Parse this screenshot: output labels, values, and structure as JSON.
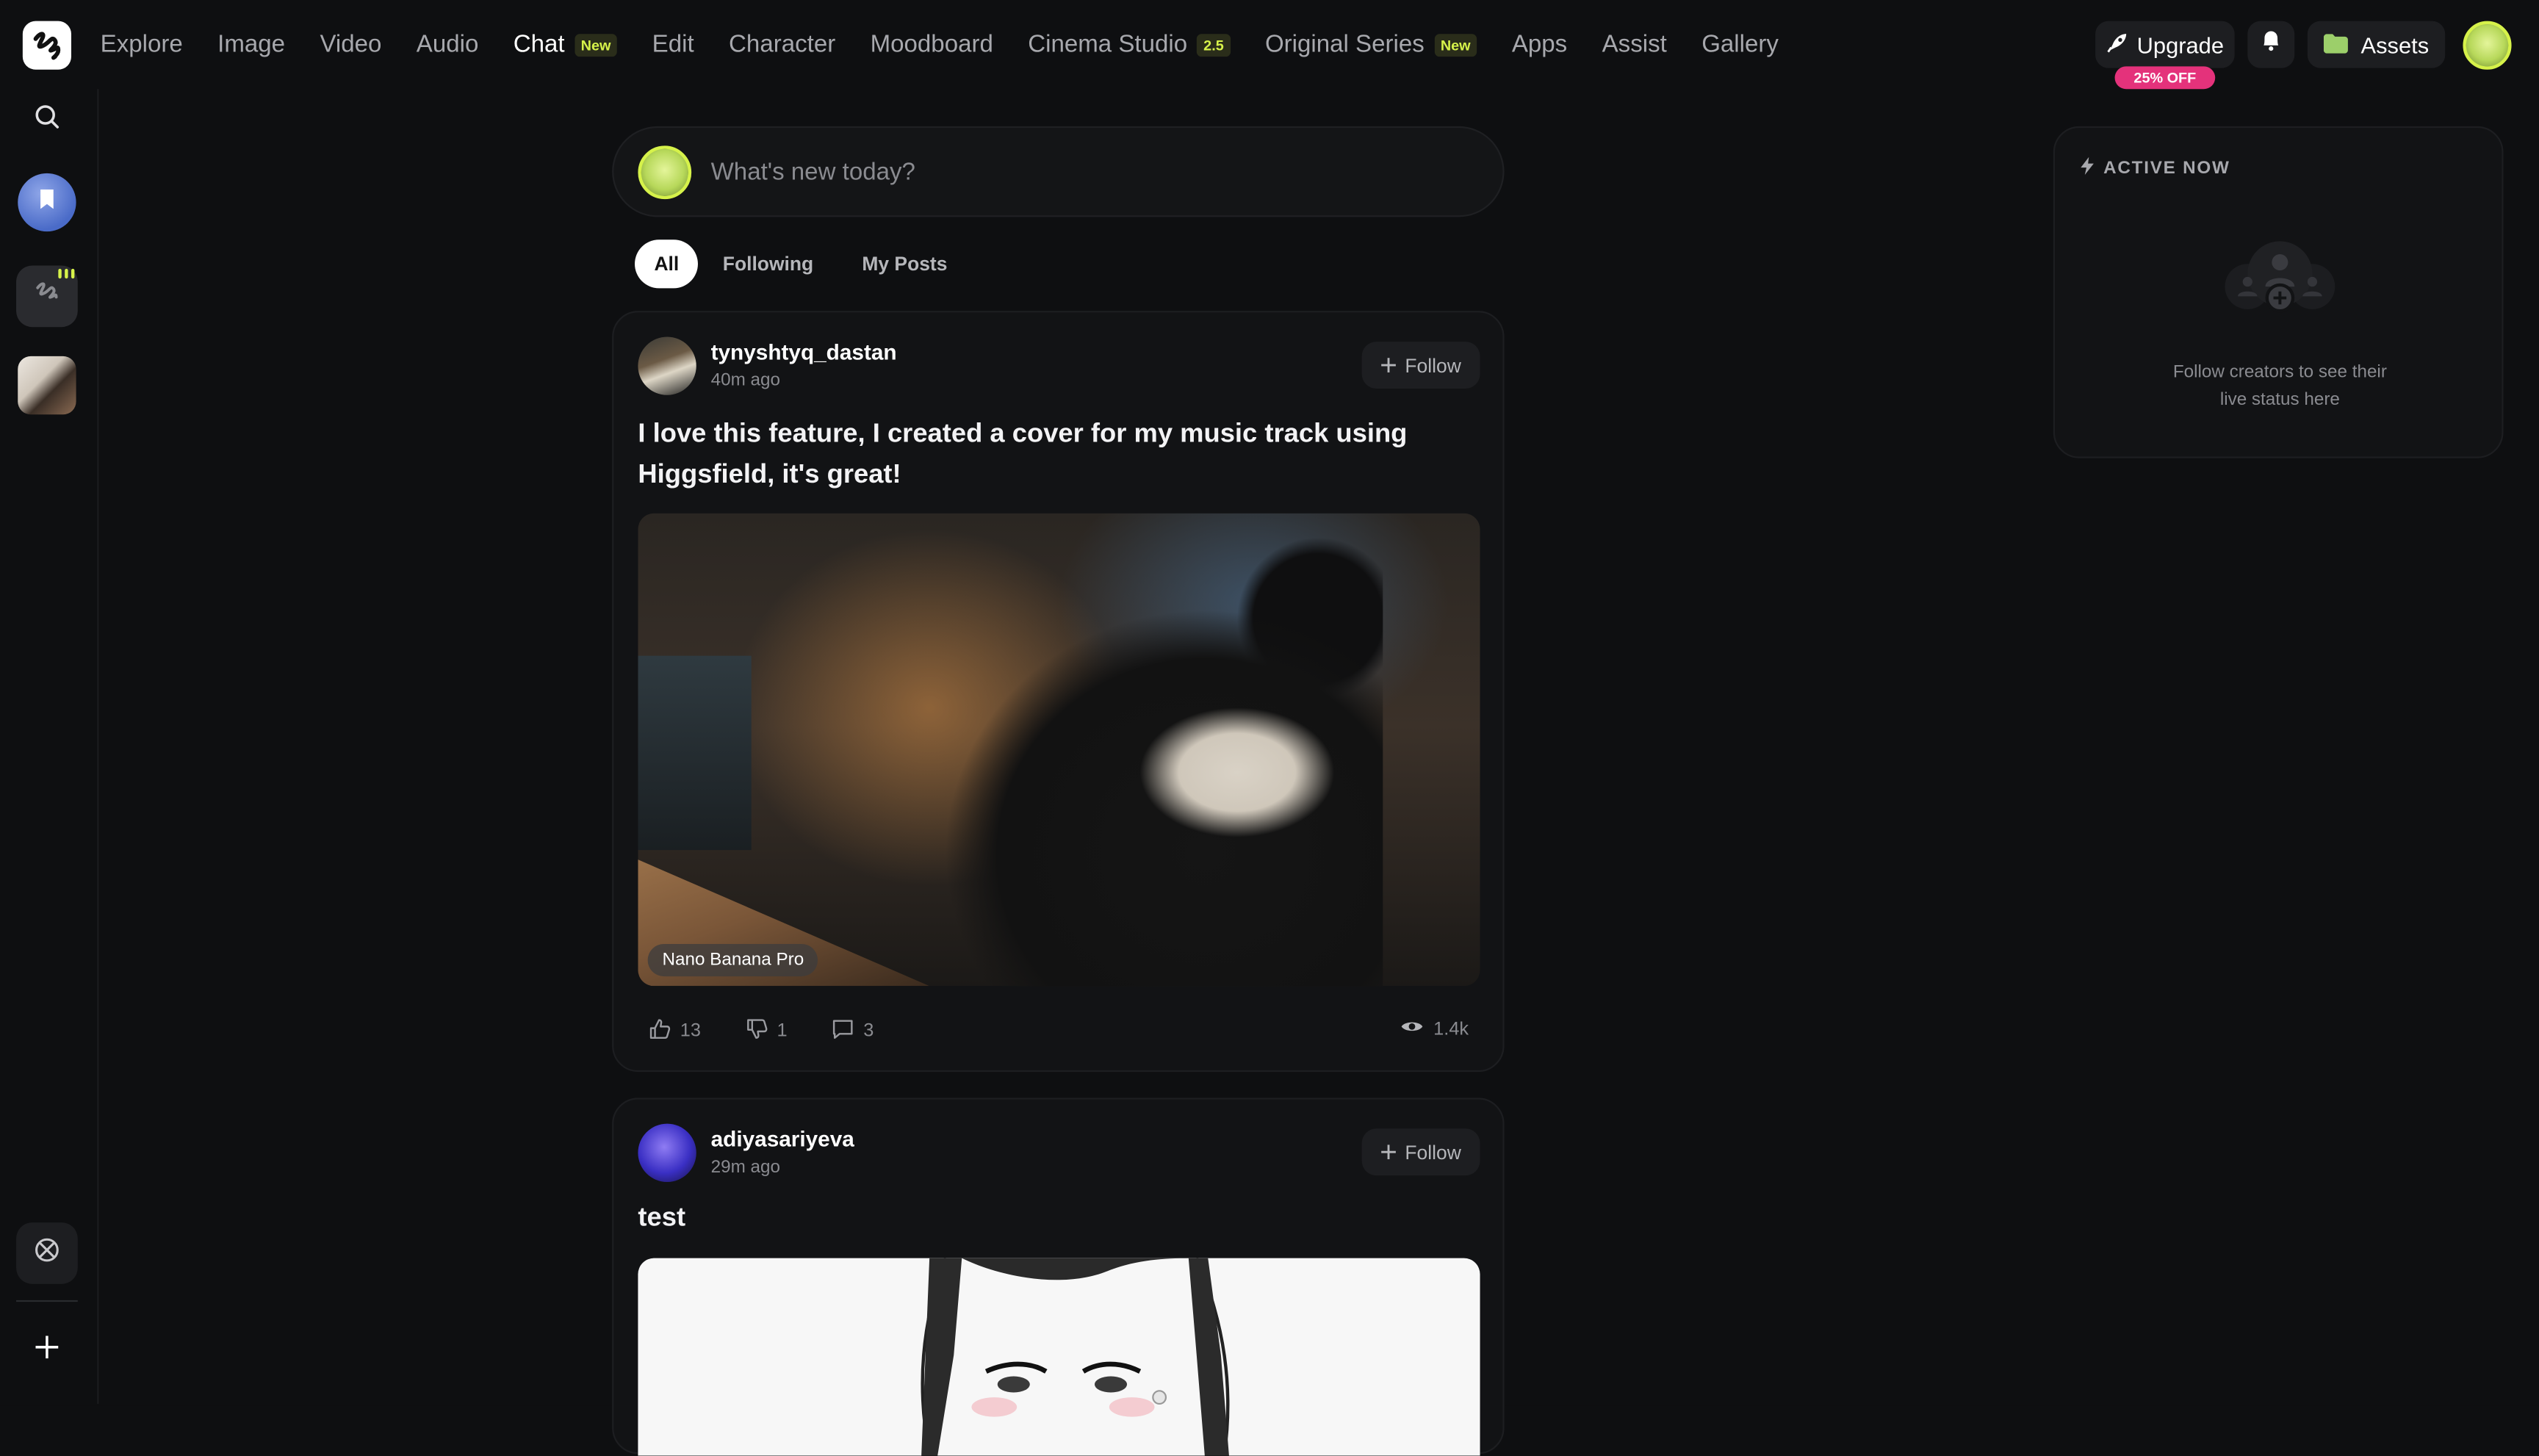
{
  "nav": {
    "items": [
      {
        "label": "Explore"
      },
      {
        "label": "Image"
      },
      {
        "label": "Video"
      },
      {
        "label": "Audio"
      },
      {
        "label": "Chat",
        "badge": "New",
        "active": true
      },
      {
        "label": "Edit"
      },
      {
        "label": "Character"
      },
      {
        "label": "Moodboard"
      },
      {
        "label": "Cinema Studio",
        "badge": "2.5"
      },
      {
        "label": "Original Series",
        "badge": "New"
      },
      {
        "label": "Apps"
      },
      {
        "label": "Assist"
      },
      {
        "label": "Gallery"
      }
    ],
    "upgrade_label": "Upgrade",
    "discount_badge": "25% OFF",
    "assets_label": "Assets"
  },
  "composer": {
    "placeholder": "What's new today?"
  },
  "tabs": [
    {
      "label": "All",
      "active": true
    },
    {
      "label": "Following"
    },
    {
      "label": "My Posts"
    }
  ],
  "posts": [
    {
      "username": "tynyshtyq_dastan",
      "time": "40m ago",
      "follow_label": "Follow",
      "text": "I love this feature, I created a cover for my music track using Higgsfield, it's great!",
      "image_label": "Nano Banana Pro",
      "likes": "13",
      "dislikes": "1",
      "comments": "3",
      "views": "1.4k"
    },
    {
      "username": "adiyasariyeva",
      "time": "29m ago",
      "follow_label": "Follow",
      "text": "test"
    }
  ],
  "active_now": {
    "title": "ACTIVE NOW",
    "empty_line1": "Follow creators to see their",
    "empty_line2": "live status here"
  },
  "colors": {
    "accent": "#d6f24a",
    "discount": "#e4327b",
    "background": "#0e0f11",
    "card": "#121315"
  }
}
